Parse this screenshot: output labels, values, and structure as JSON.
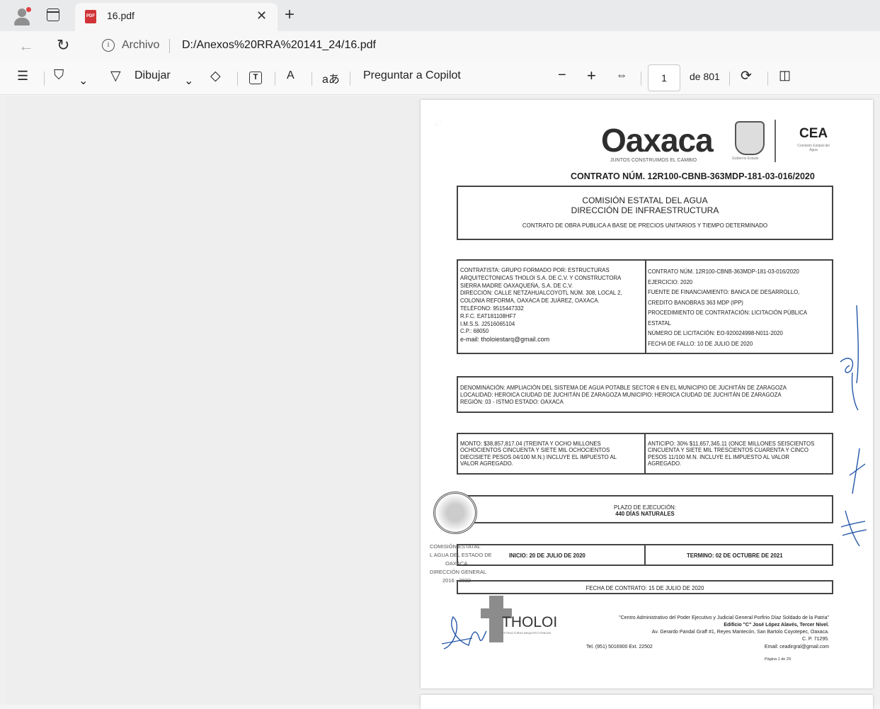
{
  "browser": {
    "tab": {
      "title": "16.pdf",
      "icon": "pdf-icon",
      "pdf_badge": "PDF"
    },
    "address": {
      "origin_label": "Archivo",
      "url": "D:/Anexos%20RRA%20141_24/16.pdf"
    }
  },
  "pdf_toolbar": {
    "draw_label": "Dibujar",
    "copilot_label": "Preguntar a Copilot",
    "page_current": "1",
    "page_total_label": "de 801",
    "zoom_out": "−",
    "zoom_in": "+",
    "text_icon_glyph": "T",
    "read_aloud_glyph": "A",
    "translate_glyph": "aあ"
  },
  "document": {
    "header": {
      "logo_text": "Oaxaca",
      "logo_tagline": "JUNTOS CONSTRUIMOS EL CAMBIO",
      "seal_caption": "Gobierno  Estado",
      "agency_abbr": "CEA",
      "agency_sub": "Comisión Estatal del Agua"
    },
    "contract_number": "CONTRATO NÚM. 12R100-CBNB-363MDP-181-03-016/2020",
    "title_box": {
      "line1": "COMISIÓN ESTATAL DEL AGUA",
      "line2": "DIRECCIÓN DE INFRAESTRUCTURA",
      "line3": "CONTRATO DE OBRA PUBLICA A BASE DE PRECIOS UNITARIOS Y TIEMPO DETERMINADO"
    },
    "parties": {
      "left": [
        "CONTRATISTA: GRUPO FORMADO POR: ESTRUCTURAS",
        "ARQUITECTONICAS THOLOI S.A. DE C.V. Y CONSTRUCTORA",
        "SIERRA MADRE OAXAQUEÑA, S.A. DE C.V.",
        "DIRECCIÓN: CALLE NETZAHUALCOYOTL NÚM. 308, LOCAL 2,",
        "COLONIA REFORMA, OAXACA DE JUÁREZ, OAXACA.",
        "TELÉFONO: 9515447332",
        "R.F.C. EAT181108HF7",
        "I.M.S.S. J2516065104",
        "C.P.: 68050",
        "e-mail: tholoiestarq@gmail.com"
      ],
      "right": [
        "CONTRATO NÚM. 12R100-CBNB-363MDP-181-03-016/2020",
        "EJERCICIO: 2020",
        "FUENTE DE FINANCIAMIENTO: BANCA DE DESARROLLO,",
        "CREDITO BANOBRAS 363 MDP (IPP)",
        "PROCEDIMIENTO DE CONTRATACIÓN: LICITACIÓN PÚBLICA",
        "ESTATAL",
        "NÚMERO DE LICITACIÓN: EO-920024998-N011-2020",
        "FECHA DE FALLO: 10 DE JULIO DE 2020"
      ]
    },
    "denomination": {
      "line1": "DENOMINACIÓN: AMPLIACIÓN DEL SISTEMA DE AGUA POTABLE SECTOR 6 EN EL MUNICIPIO DE JUCHITÁN DE ZARAGOZA",
      "line2": "LOCALIDAD: HEROICA CIUDAD DE JUCHITÁN DE ZARAGOZA MUNICIPIO: HEROICA CIUDAD DE JUCHITÁN DE ZARAGOZA",
      "line3": "REGIÓN: 03 - ISTMO     ESTADO: OAXACA"
    },
    "amounts": {
      "monto": [
        "MONTO: $38,857,817.04 (TREINTA Y OCHO MILLONES",
        "OCHOCIENTOS CINCUENTA Y SIETE MIL OCHOCIENTOS",
        "DIECISIETE PESOS 04/100 M.N.) INCLUYE EL IMPUESTO AL",
        "VALOR AGREGADO."
      ],
      "anticipo": [
        "ANTICIPO: 30% $11,657,345.11 (ONCE MILLONES SEISCIENTOS",
        "CINCUENTA Y SIETE MIL TRESCIENTOS CUARENTA Y CINCO",
        "PESOS 11/100 M.N. INCLUYE EL IMPUESTO AL VALOR",
        "AGREGADO."
      ]
    },
    "plazo": {
      "line1": "PLAZO DE EJECUCIÓN:",
      "line2": "440 DÍAS NATURALES"
    },
    "dates": {
      "inicio": "INICIO: 20 DE JULIO DE 2020",
      "termino": "TERMINO: 02 DE OCTUBRE DE 2021",
      "fecha_contrato": "FECHA DE CONTRATO: 15 DE JULIO DE 2020"
    },
    "stamp_lines": [
      "COMISIÓN ESTATAL",
      "L AGUA DEL ESTADO DE",
      "OAXACA",
      "DIRECCIÓN GENERAL",
      "2016 - 2022"
    ],
    "tholoi": {
      "word": "THOLOI",
      "sub": "ESTRUCTURAS ARQUITECTÓNICAS"
    },
    "footer": {
      "addr1": "\"Centro Administrativo del Poder Ejecutivo y Judicial General Porfirio Díaz Soldado de la Patria\"",
      "addr2": "Edificio \"C\" José López Alavés, Tercer Nivel.",
      "addr3": "Av. Gerardo Pandal Graff #1, Reyes Mantecón, San Bartolo Coyotepec, Oaxaca.",
      "addr4": "C. P. 71295.",
      "tel": "Tel. (951) 5016900 Ext. 22502",
      "email": "Email: ceadirgral@gmail.com",
      "page": "Página 1 de 29"
    }
  }
}
